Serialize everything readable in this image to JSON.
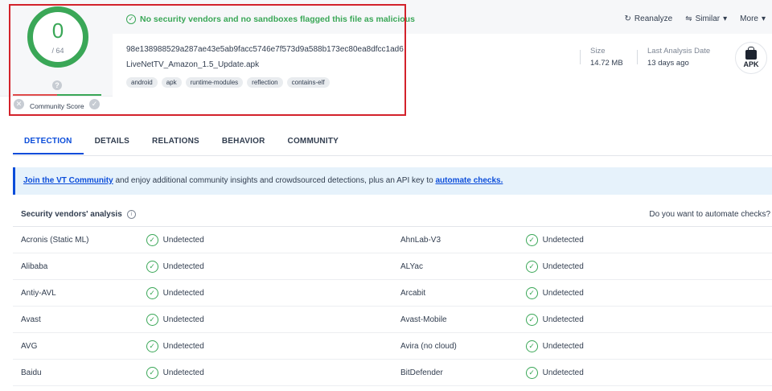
{
  "score": {
    "detections": "0",
    "total": "/ 64",
    "community_label": "Community Score"
  },
  "summary": {
    "verdict": "No security vendors and no sandboxes flagged this file as malicious",
    "hash": "98e138988529a287ae43e5ab9facc5746e7f573d9a588b173ec80ea8dfcc1ad6",
    "filename": "LiveNetTV_Amazon_1.5_Update.apk",
    "tags": [
      "android",
      "apk",
      "runtime-modules",
      "reflection",
      "contains-elf"
    ]
  },
  "actions": {
    "reanalyze": "Reanalyze",
    "similar": "Similar",
    "more": "More"
  },
  "meta": {
    "size_label": "Size",
    "size_value": "14.72 MB",
    "date_label": "Last Analysis Date",
    "date_value": "13 days ago",
    "file_type": "APK"
  },
  "tabs": [
    "DETECTION",
    "DETAILS",
    "RELATIONS",
    "BEHAVIOR",
    "COMMUNITY"
  ],
  "banner": {
    "link1": "Join the VT Community",
    "text": " and enjoy additional community insights and crowdsourced detections, plus an API key to ",
    "link2": "automate checks."
  },
  "table": {
    "title": "Security vendors' analysis",
    "automate": "Do you want to automate checks?",
    "rows": [
      {
        "v1": "Acronis (Static ML)",
        "r1": "Undetected",
        "v2": "AhnLab-V3",
        "r2": "Undetected"
      },
      {
        "v1": "Alibaba",
        "r1": "Undetected",
        "v2": "ALYac",
        "r2": "Undetected"
      },
      {
        "v1": "Antiy-AVL",
        "r1": "Undetected",
        "v2": "Arcabit",
        "r2": "Undetected"
      },
      {
        "v1": "Avast",
        "r1": "Undetected",
        "v2": "Avast-Mobile",
        "r2": "Undetected"
      },
      {
        "v1": "AVG",
        "r1": "Undetected",
        "v2": "Avira (no cloud)",
        "r2": "Undetected"
      },
      {
        "v1": "Baidu",
        "r1": "Undetected",
        "v2": "BitDefender",
        "r2": "Undetected"
      }
    ]
  },
  "colors": {
    "clean": "#3aa757",
    "accent": "#0b4dda",
    "highlight": "#d3222b"
  }
}
